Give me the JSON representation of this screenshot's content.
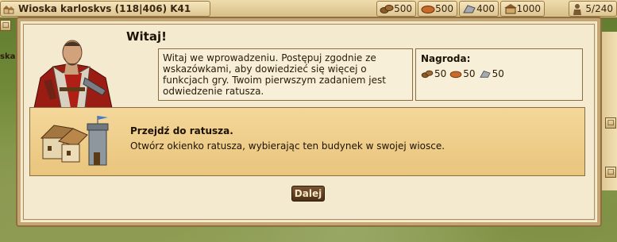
{
  "topbar": {
    "village_name": "Wioska karloskvs (118|406) K41",
    "resources": [
      {
        "icon": "wood-icon",
        "value": "500"
      },
      {
        "icon": "clay-icon",
        "value": "500"
      },
      {
        "icon": "iron-icon",
        "value": "400"
      },
      {
        "icon": "storage-icon",
        "value": "1000"
      },
      {
        "icon": "population-icon",
        "value": "5/240"
      }
    ]
  },
  "dialog": {
    "title": "Witaj!",
    "intro_text": "Witaj we wprowadzeniu. Postępuj zgodnie ze wskazówkami, aby dowiedzieć się więcej o funkcjach gry. Twoim pierwszym zadaniem jest odwiedzenie ratusza.",
    "reward": {
      "label": "Nagroda:",
      "items": [
        {
          "icon": "wood-icon",
          "value": "50"
        },
        {
          "icon": "clay-icon",
          "value": "50"
        },
        {
          "icon": "iron-icon",
          "value": "50"
        }
      ]
    },
    "task": {
      "title": "Przejdź do ratusza.",
      "description": "Otwórz okienko ratusza, wybierając ten budynek w swojej wiosce."
    },
    "next_button": "Dalej"
  }
}
